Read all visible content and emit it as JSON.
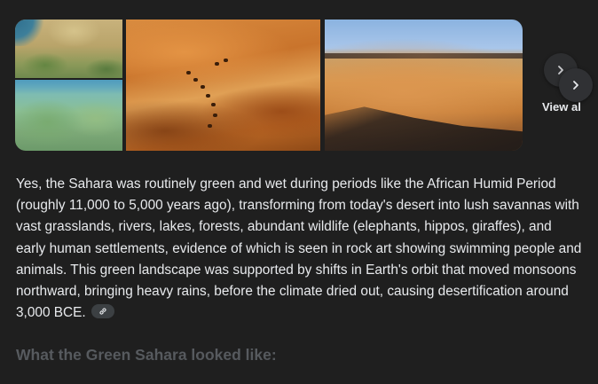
{
  "images": [
    {
      "name": "sahara-map-satellite"
    },
    {
      "name": "sahara-map-green"
    },
    {
      "name": "sahara-dunes-caravan"
    },
    {
      "name": "sahara-rock-desert"
    }
  ],
  "carousel": {
    "next_icon": "chevron-right-icon",
    "view_all_label": "View all"
  },
  "answer": {
    "text": "Yes, the Sahara was routinely green and wet during periods like the African Humid Period (roughly 11,000 to 5,000 years ago), transforming from today's desert into lush savannas with vast grasslands, rivers, lakes, forests, abundant wildlife (elephants, hippos, giraffes), and early human settlements, evidence of which is seen in rock art showing swimming people and animals. This green landscape was supported by shifts in Earth's orbit that moved monsoons northward, bringing heavy rains, before the climate dried out, causing desertification around 3,000 BCE.",
    "link_icon": "link-icon"
  },
  "section": {
    "heading": "What the Green Sahara looked like:"
  },
  "colors": {
    "background": "#1f1f1f",
    "text": "#e8eaed",
    "muted_heading": "#5f6368",
    "chip": "#3c4043",
    "button": "#303134"
  }
}
